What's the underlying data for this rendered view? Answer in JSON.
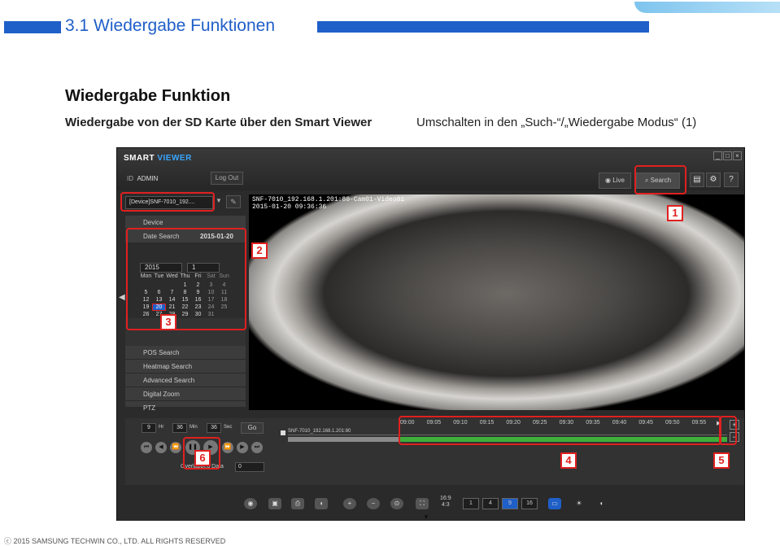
{
  "slide": {
    "title": "3.1 Wiedergabe Funktionen",
    "heading": "Wiedergabe Funktion",
    "subtitle_left": "Wiedergabe von der SD Karte über den Smart Viewer",
    "subtitle_right": "Umschalten in den „Such-“/„Wiedergabe Modus“ (1)",
    "footer": "ⓒ 2015 SAMSUNG TECHWIN CO., LTD. ALL RIGHTS RESERVED",
    "accent_color": "#1f5fc8"
  },
  "app": {
    "logo_smart": "SMART",
    "logo_viewer": "VIEWER",
    "id_label": "ID",
    "id_value": "ADMIN",
    "logout_label": "Log Out",
    "live_label": "Live",
    "search_label": "Search",
    "device_select": "[Device]SNF-7010_192....",
    "sections": {
      "device": "Device",
      "date_search": "Date Search",
      "date_value": "2015-01-20",
      "pos_search": "POS Search",
      "heatmap_search": "Heatmap Search",
      "advanced_search": "Advanced Search",
      "digital_zoom": "Digital Zoom",
      "ptz": "PTZ"
    },
    "calendar": {
      "year": "2015",
      "month": "1",
      "weekdays": [
        "Mon",
        "Tue",
        "Wed",
        "Thu",
        "Fri",
        "Sat",
        "Sun"
      ],
      "rows": [
        [
          "",
          "",
          "",
          "1",
          "2",
          "3",
          "4"
        ],
        [
          "5",
          "6",
          "7",
          "8",
          "9",
          "10",
          "11"
        ],
        [
          "12",
          "13",
          "14",
          "15",
          "16",
          "17",
          "18"
        ],
        [
          "19",
          "20",
          "21",
          "22",
          "23",
          "24",
          "25"
        ],
        [
          "26",
          "27",
          "28",
          "29",
          "30",
          "31",
          ""
        ]
      ],
      "selected": "20"
    },
    "video": {
      "camera_label": "SNF-7010_192.168.1.201:80-Cam01-Video01",
      "timestamp": "2015-01-20 09:36:36"
    },
    "time_controls": {
      "hr_value": "9",
      "hr_label": "Hr",
      "min_value": "36",
      "min_label": "Min",
      "sec_value": "36",
      "sec_label": "Sec",
      "go_label": "Go"
    },
    "timeline": {
      "channel_label": "SNF-7010_192.168.1.201:80",
      "ticks": [
        "09:00",
        "09:05",
        "09:10",
        "09:15",
        "09:20",
        "09:25",
        "09:30",
        "09:35",
        "09:40",
        "09:45",
        "09:50",
        "09:55"
      ]
    },
    "overlapped_label": "Overlapped Data",
    "overlapped_value": "0",
    "layout_time_top": "16:9",
    "layout_time_bottom": "4:3",
    "layout_buttons": [
      "1",
      "4",
      "9",
      "16"
    ]
  },
  "callouts": [
    "1",
    "2",
    "3",
    "4",
    "5",
    "6"
  ]
}
